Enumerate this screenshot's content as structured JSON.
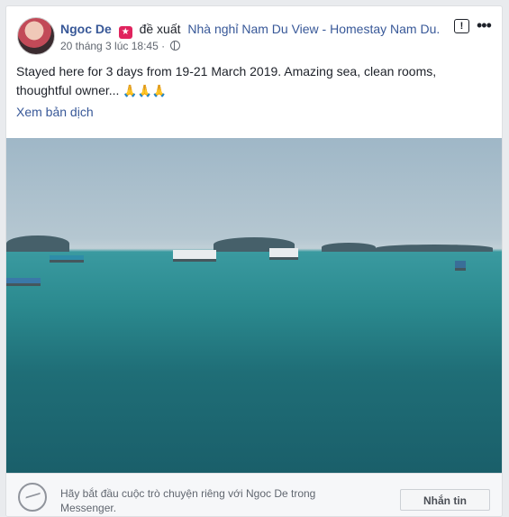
{
  "post": {
    "author": "Ngoc De",
    "action": "đề xuất",
    "page": "Nhà nghỉ Nam Du View - Homestay Nam Du.",
    "timestamp": "20 tháng 3 lúc 18:45 ·",
    "text": "Stayed here for 3 days from 19-21 March 2019. Amazing sea, clean rooms, thoughtful owner...",
    "emoji": "🙏🙏🙏",
    "translate": "Xem bản dịch",
    "icons": {
      "privacy": "globe-icon",
      "report": "report-icon",
      "more": "more-icon",
      "recommend": "recommend-badge-icon"
    }
  },
  "footer": {
    "prompt": "Hãy bắt đầu cuộc trò chuyện riêng với Ngoc De trong Messenger.",
    "button": "Nhắn tin",
    "icon": "messenger-icon"
  },
  "colors": {
    "link": "#385898",
    "badge": "#e0245e",
    "text": "#1d2129"
  }
}
